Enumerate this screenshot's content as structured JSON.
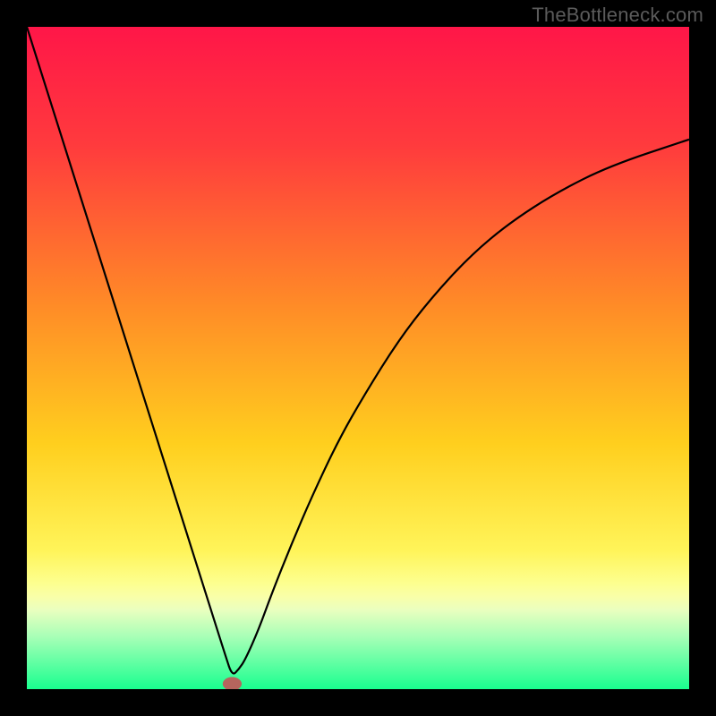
{
  "watermark": "TheBottleneck.com",
  "colors": {
    "frame": "#000000",
    "gradient_stops": [
      {
        "offset": "0%",
        "color": "#ff1648"
      },
      {
        "offset": "18%",
        "color": "#ff3b3d"
      },
      {
        "offset": "42%",
        "color": "#ff8b27"
      },
      {
        "offset": "63%",
        "color": "#ffcf1e"
      },
      {
        "offset": "79%",
        "color": "#fff459"
      },
      {
        "offset": "84%",
        "color": "#fdff8f"
      },
      {
        "offset": "86%",
        "color": "#f9ffa8"
      },
      {
        "offset": "88%",
        "color": "#eaffbf"
      },
      {
        "offset": "92%",
        "color": "#a9ffb7"
      },
      {
        "offset": "100%",
        "color": "#19ff8f"
      }
    ],
    "curve": "#000000",
    "marker_fill": "#b5655d",
    "marker_stroke": "#b5655d"
  },
  "chart_data": {
    "type": "line",
    "title": "",
    "xlabel": "",
    "ylabel": "",
    "xlim": [
      0,
      100
    ],
    "ylim": [
      0,
      100
    ],
    "grid": false,
    "legend": false,
    "annotations": [
      {
        "type": "marker",
        "shape": "ellipse",
        "x": 31,
        "y": 0.8,
        "rx": 1.4,
        "ry": 1.0,
        "name": "min-marker"
      }
    ],
    "series": [
      {
        "name": "bottleneck-curve",
        "x": [
          0,
          3,
          6,
          9,
          12,
          15,
          18,
          21,
          24,
          27,
          30,
          31,
          32,
          33,
          35,
          37,
          40,
          43,
          47,
          51,
          56,
          61,
          67,
          73,
          80,
          88,
          100
        ],
        "y": [
          100,
          90.5,
          81.0,
          71.5,
          62.0,
          52.5,
          43.0,
          33.5,
          24.0,
          14.5,
          5.0,
          2.0,
          3.0,
          4.5,
          9.0,
          14.5,
          22.0,
          29.0,
          37.5,
          44.5,
          52.5,
          59.0,
          65.5,
          70.5,
          75.0,
          79.0,
          83.0
        ]
      }
    ]
  }
}
